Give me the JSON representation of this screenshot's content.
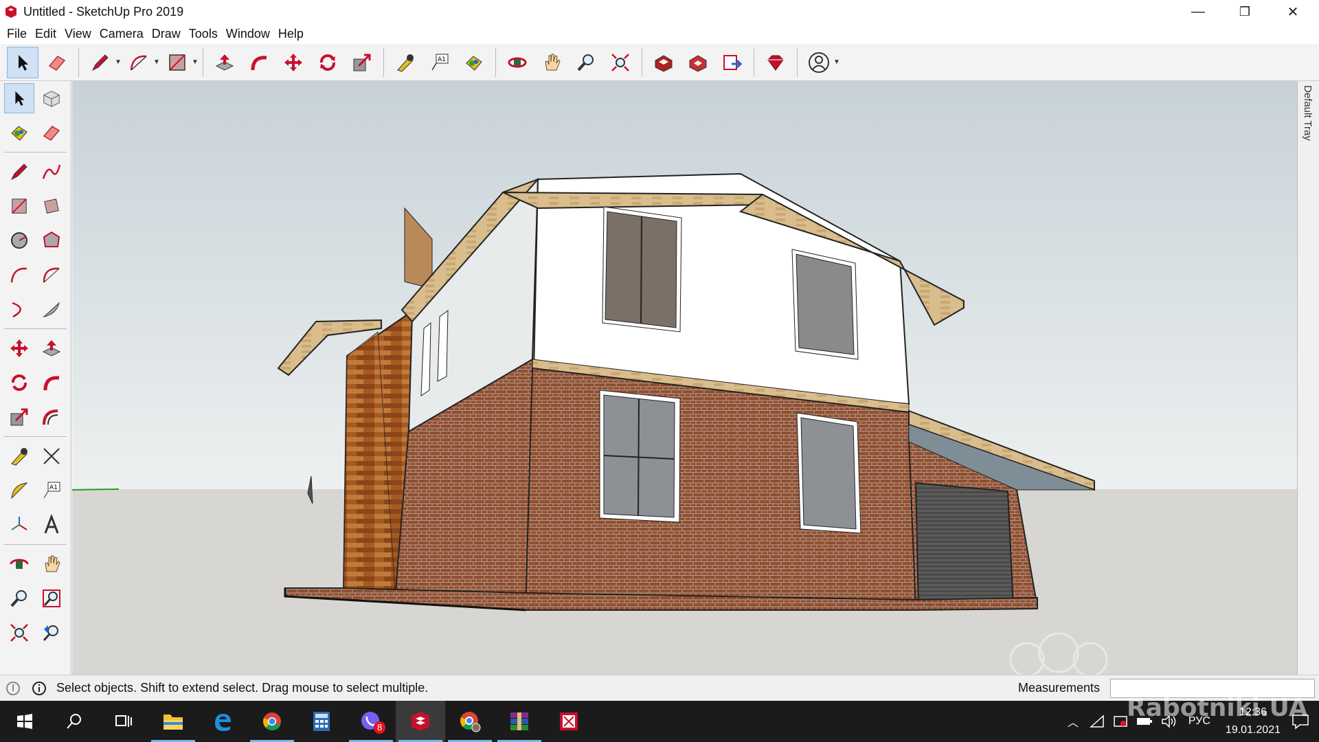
{
  "window": {
    "title": "Untitled - SketchUp Pro 2019",
    "minimize": "—",
    "restore": "❐",
    "close": "✕"
  },
  "menu": [
    "File",
    "Edit",
    "View",
    "Camera",
    "Draw",
    "Tools",
    "Window",
    "Help"
  ],
  "toolbar": {
    "icons": [
      "select-icon",
      "eraser-icon",
      "pencil-icon",
      "arc-icon",
      "rectangle-icon",
      "push-pull-icon",
      "follow-me-icon",
      "move-icon",
      "rotate-icon",
      "scale-icon",
      "tape-measure-icon",
      "text-icon",
      "paint-bucket-icon",
      "orbit-icon",
      "pan-icon",
      "zoom-icon",
      "zoom-extents-icon",
      "3d-warehouse-icon",
      "extension-warehouse-icon",
      "send-to-layout-icon",
      "ruby-icon",
      "account-icon"
    ]
  },
  "tray": {
    "label": "Default Tray"
  },
  "status": {
    "hint": "Select objects. Shift to extend select. Drag mouse to select multiple.",
    "measurements_label": "Measurements",
    "measurements_value": ""
  },
  "taskbar": {
    "apps": [
      "windows-start-icon",
      "search-icon",
      "task-view-icon",
      "file-explorer-icon",
      "edge-icon",
      "chrome-icon",
      "calculator-icon",
      "viber-icon",
      "sketchup-icon",
      "chrome-profile-icon",
      "winrar-icon",
      "layout-icon"
    ],
    "viber_badge": "8",
    "lang": "РУС",
    "time": "12:36",
    "date": "19.01.2021"
  },
  "watermark": "Rabotniki.UA",
  "colors": {
    "accent": "#c8102e",
    "sky_top": "#c8d3da",
    "ground": "#d8d6d2",
    "brick": "#8a4a30",
    "roof": "#d6b98a"
  }
}
